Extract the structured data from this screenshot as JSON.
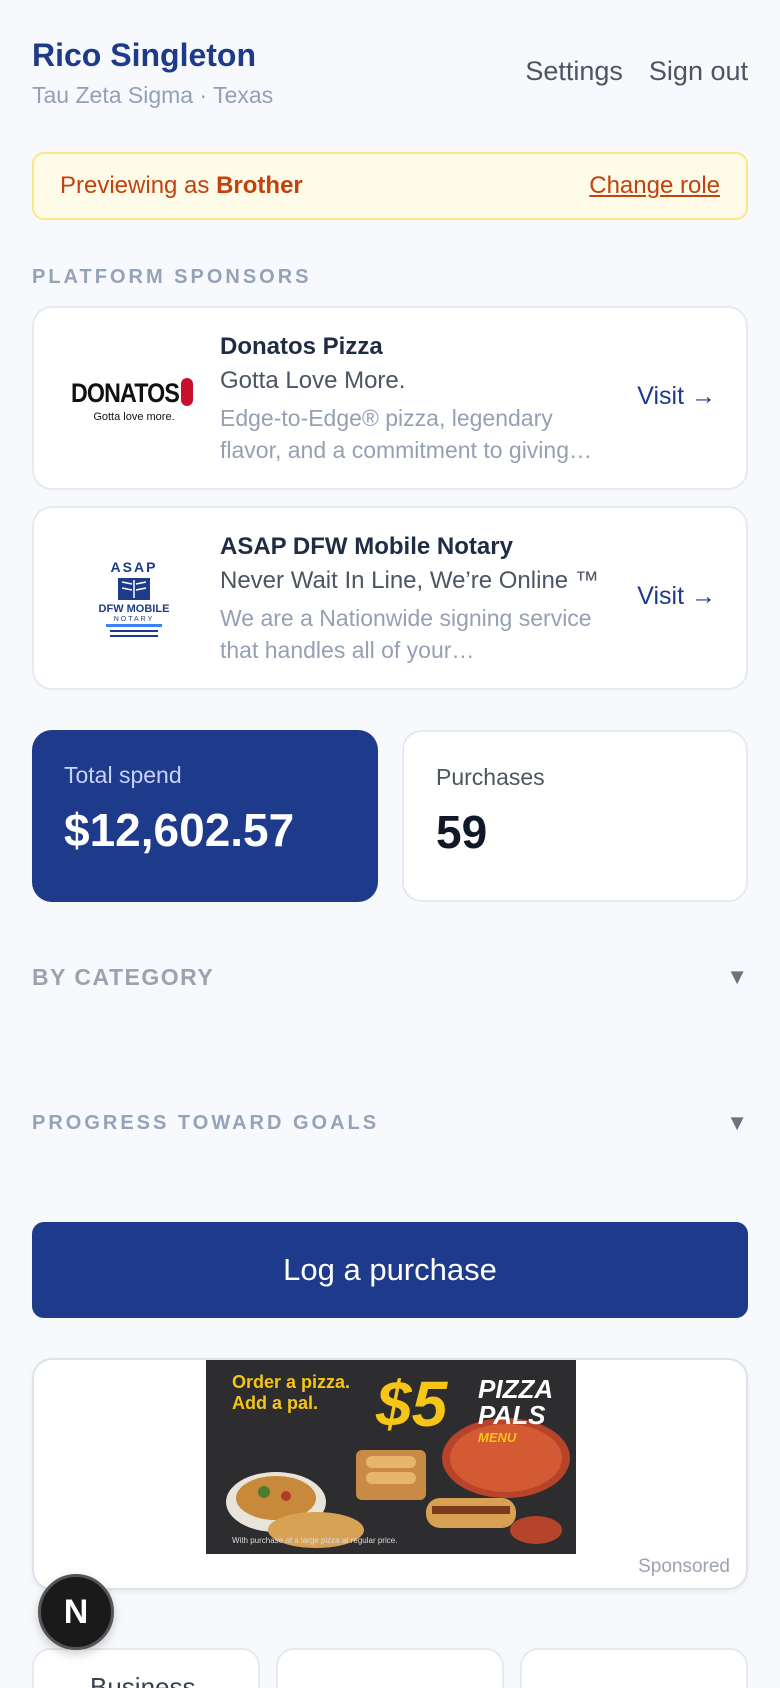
{
  "header": {
    "user_name": "Rico Singleton",
    "subtitle": "Tau Zeta Sigma · Texas",
    "links": [
      "Settings",
      "Sign out"
    ]
  },
  "role_banner": {
    "prefix": "Previewing as ",
    "role": "Brother",
    "change_label": "Change role"
  },
  "sponsors": {
    "section_label": "PLATFORM SPONSORS",
    "items": [
      {
        "name": "Donatos Pizza",
        "tagline": "Gotta Love More.",
        "description": "Edge-to-Edge® pizza, legendary flavor, and a commitment to giving…",
        "visit_label": "Visit →",
        "logo_text": "DONATOS",
        "logo_sub": "Gotta love more."
      },
      {
        "name": "ASAP DFW Mobile Notary",
        "tagline": "Never Wait In Line, We’re Online ™",
        "description": "We are a Nationwide signing service that handles all of your…",
        "visit_label": "Visit →",
        "logo_text": "ASAP",
        "logo_sub": "DFW MOBILE"
      }
    ]
  },
  "stats": {
    "total_spend_label": "Total spend",
    "total_spend_value": "$12,602.57",
    "purchases_label": "Purchases",
    "purchases_value": "59"
  },
  "sections": {
    "by_category": "BY CATEGORY",
    "progress_goals": "PROGRESS TOWARD GOALS"
  },
  "actions": {
    "log_purchase": "Log a purchase"
  },
  "ad": {
    "headline": "Order a pizza. Add a pal.",
    "price": "$5",
    "promo": "PIZZA PALS",
    "promo_sub": "MENU",
    "fine_print": "With purchase of a large pizza at regular price.",
    "sponsored_label": "Sponsored"
  },
  "next_badge": "N",
  "tiles": [
    {
      "label": "Business"
    },
    {
      "label": ""
    },
    {
      "label": ""
    }
  ],
  "colors": {
    "primary": "#1e3a8a",
    "banner_bg": "#fefbe8",
    "banner_text": "#c2410c"
  }
}
